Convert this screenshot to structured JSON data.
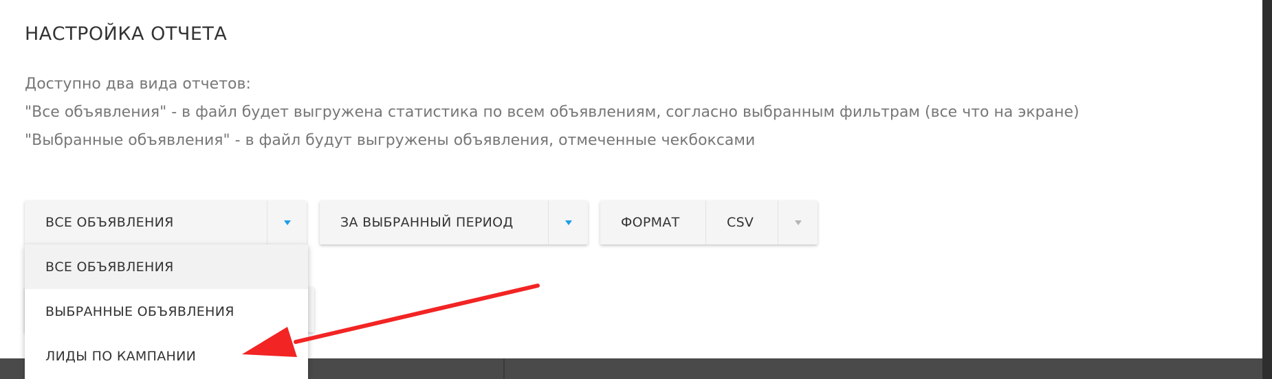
{
  "modal": {
    "title": "НАСТРОЙКА ОТЧЕТА",
    "description": [
      "Доступно два вида отчетов:",
      "\"Все объявления\" - в файл будет выгружена статистика по всем объявлениям, согласно выбранным фильтрам (все что на экране)",
      "\"Выбранные объявления\" - в файл будут выгружены объявления, отмеченные чекбоксами"
    ]
  },
  "controls": {
    "report_type": {
      "selected": "ВСЕ ОБЪЯВЛЕНИЯ"
    },
    "period": {
      "selected": "ЗА ВЫБРАННЫЙ ПЕРИОД"
    },
    "format": {
      "label": "ФОРМАТ",
      "selected": "CSV"
    }
  },
  "dropdown": {
    "items": [
      {
        "label": "ВСЕ ОБЪЯВЛЕНИЯ",
        "active": true
      },
      {
        "label": "ВЫБРАННЫЕ ОБЪЯВЛЕНИЯ",
        "active": false
      },
      {
        "label": "ЛИДЫ ПО КАМПАНИИ",
        "active": false
      }
    ]
  },
  "colors": {
    "accent": "#1e9ee8",
    "annotation": "#f22424",
    "text": "#333333",
    "muted": "#777777"
  },
  "icons": {
    "dropdown_caret": "triangle-down-icon",
    "annotation": "red-arrow-icon"
  }
}
